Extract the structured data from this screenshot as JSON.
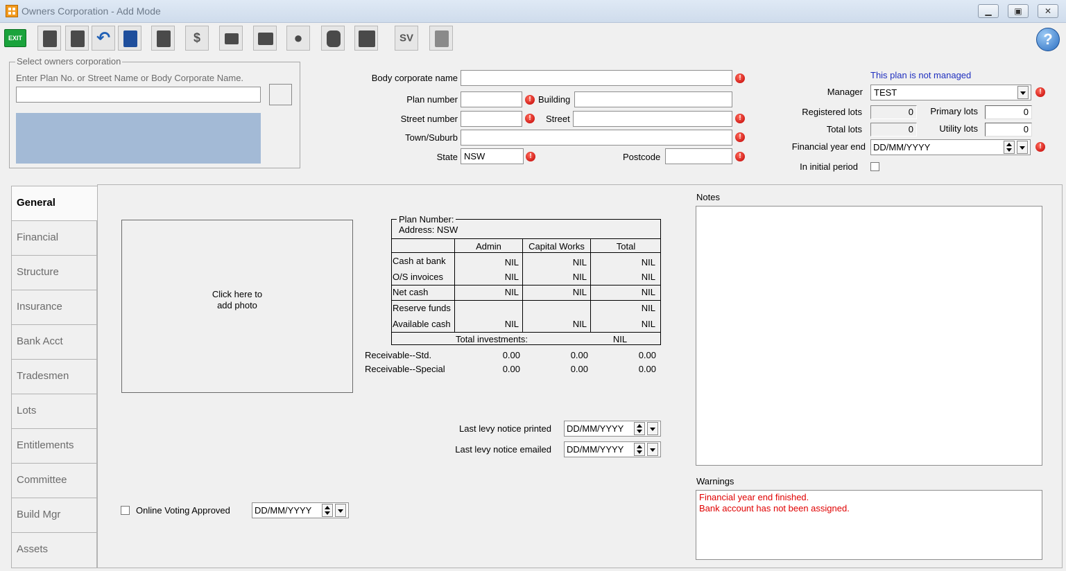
{
  "window": {
    "title": "Owners Corporation - Add Mode"
  },
  "toolbar": {
    "exit_label": "EXIT",
    "help_label": "?",
    "sv_label": "SV"
  },
  "select": {
    "legend": "Select owners corporation",
    "hint": "Enter Plan No. or Street Name or Body Corporate Name.",
    "search_value": ""
  },
  "form": {
    "body_corporate_name_label": "Body corporate name",
    "plan_number_label": "Plan number",
    "building_label": "Building",
    "street_number_label": "Street number",
    "street_label": "Street",
    "town_label": "Town/Suburb",
    "state_label": "State",
    "state_value": "NSW",
    "postcode_label": "Postcode"
  },
  "management": {
    "status_text": "This plan is not managed",
    "manager_label": "Manager",
    "manager_value": "TEST",
    "registered_lots_label": "Registered lots",
    "registered_lots_value": "0",
    "primary_lots_label": "Primary lots",
    "primary_lots_value": "0",
    "total_lots_label": "Total lots",
    "total_lots_value": "0",
    "utility_lots_label": "Utility lots",
    "utility_lots_value": "0",
    "financial_year_end_label": "Financial year end",
    "financial_year_end_value": "DD/MM/YYYY",
    "initial_period_label": "In initial period"
  },
  "tabs": [
    "General",
    "Financial",
    "Structure",
    "Insurance",
    "Bank Acct",
    "Tradesmen",
    "Lots",
    "Entitlements",
    "Committee",
    "Build Mgr",
    "Assets"
  ],
  "photo": {
    "line1": "Click here to",
    "line2": "add photo"
  },
  "summary": {
    "plan_number_label": "Plan Number:",
    "address_label": "Address: NSW",
    "col_admin": "Admin",
    "col_capital": "Capital Works",
    "col_total": "Total",
    "rows": [
      {
        "label": "Cash at bank",
        "admin": "NIL",
        "capital": "NIL",
        "total": "NIL"
      },
      {
        "label": "O/S invoices",
        "admin": "NIL",
        "capital": "NIL",
        "total": "NIL"
      },
      {
        "label": "Net cash",
        "admin": "NIL",
        "capital": "NIL",
        "total": "NIL"
      },
      {
        "label": "Reserve funds",
        "admin": "",
        "capital": "",
        "total": "NIL"
      },
      {
        "label": "Available cash",
        "admin": "NIL",
        "capital": "NIL",
        "total": "NIL"
      }
    ],
    "total_investments_label": "Total investments:",
    "total_investments_value": "NIL",
    "receivable_std_label": "Receivable--Std.",
    "receivable_std": [
      "0.00",
      "0.00",
      "0.00"
    ],
    "receivable_special_label": "Receivable--Special",
    "receivable_special": [
      "0.00",
      "0.00",
      "0.00"
    ]
  },
  "levy": {
    "printed_label": "Last levy notice printed",
    "printed_value": "DD/MM/YYYY",
    "emailed_label": "Last levy notice emailed",
    "emailed_value": "DD/MM/YYYY"
  },
  "voting": {
    "label": "Online Voting Approved",
    "date_value": "DD/MM/YYYY"
  },
  "notes": {
    "label": "Notes"
  },
  "warnings": {
    "label": "Warnings",
    "lines": [
      "Financial year end finished.",
      "Bank account has not been assigned."
    ],
    "color": "#e00000"
  },
  "colors": {
    "link_blue": "#1f2fbf",
    "photo_preview": "#a3bad6"
  }
}
